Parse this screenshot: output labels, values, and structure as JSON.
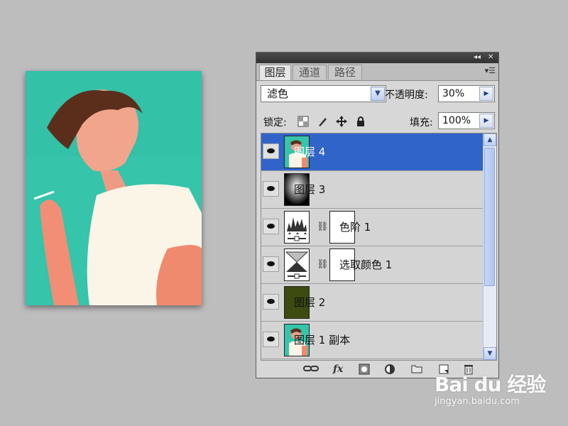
{
  "panel": {
    "tabs": [
      {
        "label": "图层"
      },
      {
        "label": "通道"
      },
      {
        "label": "路径"
      }
    ],
    "titlebar": {
      "collapse_glyph": "◂◂",
      "close_glyph": "✕"
    },
    "menu_icon": "panel-menu-icon",
    "blend_mode": {
      "value": "滤色"
    },
    "opacity": {
      "label": "不透明度:",
      "value": "30%"
    },
    "lock": {
      "label": "锁定:"
    },
    "fill": {
      "label": "填充:",
      "value": "100%"
    },
    "layers": [
      {
        "name": "图层 4",
        "selected": true,
        "thumb": "photo",
        "has_mask": false
      },
      {
        "name": "图层 3",
        "selected": false,
        "thumb": "gradient",
        "has_mask": false
      },
      {
        "name": "色阶 1",
        "selected": false,
        "thumb": "levels-adjustment",
        "has_mask": true
      },
      {
        "name": "选取颜色 1",
        "selected": false,
        "thumb": "selective-color-adjustment",
        "has_mask": true
      },
      {
        "name": "图层 2",
        "selected": false,
        "thumb": "olive-fill",
        "has_mask": false
      },
      {
        "name": "图层 1 副本",
        "selected": false,
        "thumb": "photo",
        "has_mask": false
      }
    ],
    "bottom_icons": [
      "link-layers-icon",
      "fx-icon",
      "add-mask-icon",
      "adjustment-layer-icon",
      "new-group-icon",
      "new-layer-icon",
      "trash-icon"
    ],
    "bottom_fx_text": "fx"
  },
  "colors": {
    "selected_row": "#3164c8",
    "photo_bg": "#36c4aa",
    "olive_fill": "#3d4a10"
  },
  "watermark": {
    "main": "Bai du 经验",
    "sub": "jingyan.baidu.com"
  }
}
